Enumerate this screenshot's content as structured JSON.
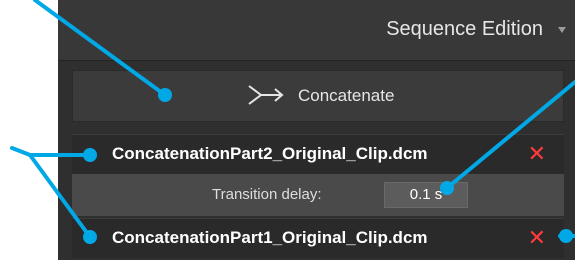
{
  "header": {
    "title": "Sequence Edition"
  },
  "concatenate_button": {
    "label": "Concatenate",
    "icon": "merge-arrow-icon"
  },
  "clips": [
    {
      "name": "ConcatenationPart2_Original_Clip.dcm",
      "remove_glyph": "✕"
    },
    {
      "name": "ConcatenationPart1_Original_Clip.dcm",
      "remove_glyph": "✕"
    }
  ],
  "transition": {
    "label": "Transition delay:",
    "value": "0.1 s"
  },
  "colors": {
    "callout": "#00a8e6",
    "remove": "#ff3b3b",
    "panel": "#2f2f2f"
  }
}
